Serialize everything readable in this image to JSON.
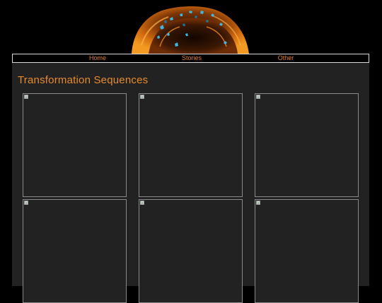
{
  "banner": {
    "image": "orange-creature-banner",
    "colors": {
      "orange": "#e07a12",
      "dark_orange": "#8a3c05",
      "cyan": "#3fb8e0"
    }
  },
  "nav": {
    "items": [
      {
        "label": "Home"
      },
      {
        "label": "Stories"
      },
      {
        "label": "Other"
      }
    ],
    "link_color": "#e07b2a"
  },
  "page": {
    "title": "Transformation Sequences",
    "title_color": "#e88a2c",
    "background": "#222222"
  },
  "gallery": {
    "thumbnail_count": 6,
    "image_state": "broken-image-icon"
  }
}
